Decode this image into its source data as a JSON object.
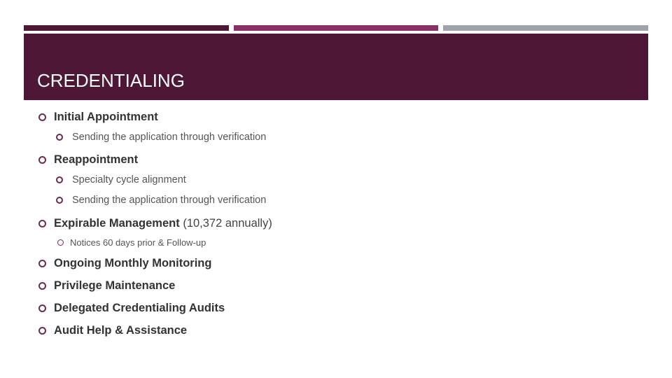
{
  "slide": {
    "title": "CREDENTIALING",
    "colors": {
      "accent_dark": "#4f1736",
      "accent_mid": "#8b2f66",
      "accent_gray": "#9ea4aa",
      "text": "#333333",
      "bullet": "#6b2c4f"
    },
    "items": [
      {
        "level": 1,
        "text": "Initial Appointment",
        "suffix": ""
      },
      {
        "level": 2,
        "text": "Sending the application through verification"
      },
      {
        "level": 1,
        "text": "Reappointment",
        "suffix": ""
      },
      {
        "level": 2,
        "text": "Specialty cycle alignment"
      },
      {
        "level": 2,
        "text": "Sending the application through verification"
      },
      {
        "level": 1,
        "text": "Expirable Management",
        "suffix": " (10,372 annually)"
      },
      {
        "level": 3,
        "text": "Notices 60 days prior & Follow-up"
      },
      {
        "level": 1,
        "text": "Ongoing Monthly Monitoring",
        "suffix": ""
      },
      {
        "level": 1,
        "text": "Privilege Maintenance",
        "suffix": ""
      },
      {
        "level": 1,
        "text": "Delegated Credentialing Audits",
        "suffix": ""
      },
      {
        "level": 1,
        "text": "Audit Help & Assistance",
        "suffix": ""
      }
    ]
  }
}
